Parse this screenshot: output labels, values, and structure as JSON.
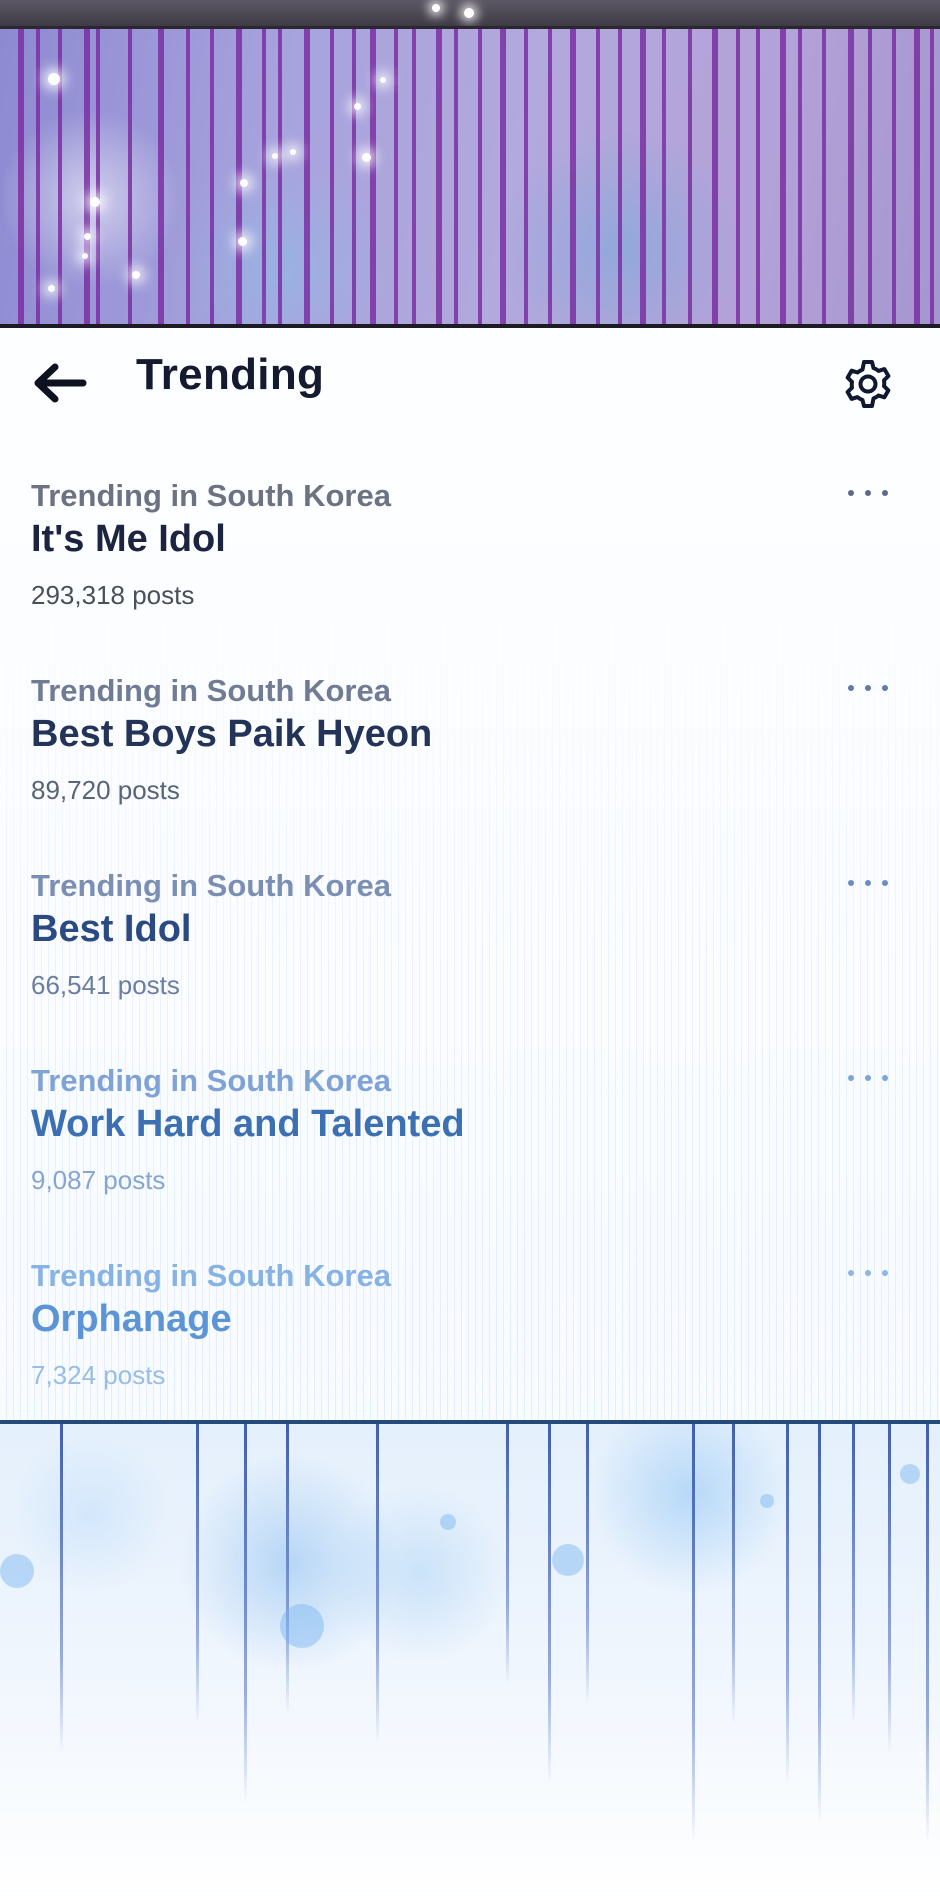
{
  "header": {
    "back_icon": "arrow-left-icon",
    "title": "Trending",
    "settings_icon": "gear-icon"
  },
  "trends": [
    {
      "context": "Trending in South Korea",
      "name": "It's Me Idol",
      "count": "293,318 posts",
      "more_icon": "more-horizontal-icon"
    },
    {
      "context": "Trending in South Korea",
      "name": "Best Boys Paik Hyeon",
      "count": "89,720 posts",
      "more_icon": "more-horizontal-icon"
    },
    {
      "context": "Trending in South Korea",
      "name": "Best Idol",
      "count": "66,541 posts",
      "more_icon": "more-horizontal-icon"
    },
    {
      "context": "Trending in South Korea",
      "name": "Work Hard and Talented",
      "count": "9,087 posts",
      "more_icon": "more-horizontal-icon"
    },
    {
      "context": "Trending in South Korea",
      "name": "Orphanage",
      "count": "7,324 posts",
      "more_icon": "more-horizontal-icon"
    }
  ],
  "colors": {
    "banner_stripe": "#7a2fa2",
    "title_text": "#141a30",
    "bottom_line": "#3f5fae"
  }
}
